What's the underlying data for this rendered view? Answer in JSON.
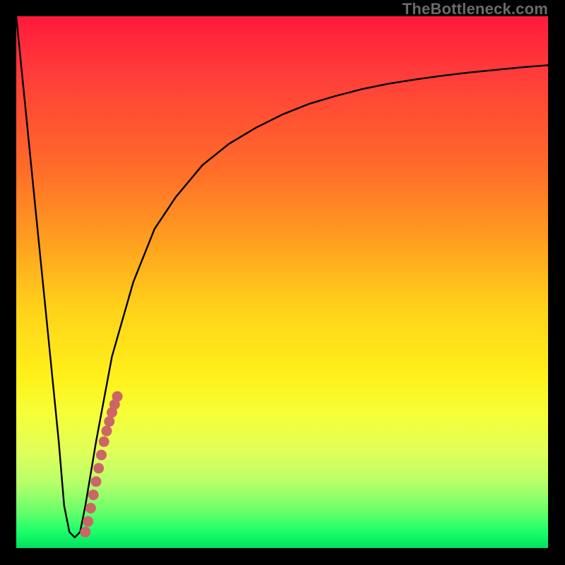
{
  "watermark": {
    "text": "TheBottleneck.com"
  },
  "colors": {
    "background": "#000000",
    "curve": "#000000",
    "marker": "#cc6666",
    "gradient_top": "#ff1a3a",
    "gradient_mid1": "#ff9e1f",
    "gradient_mid2": "#fff11a",
    "gradient_bottom": "#00e060"
  },
  "chart_data": {
    "type": "line",
    "title": "",
    "xlabel": "",
    "ylabel": "",
    "xlim": [
      0,
      100
    ],
    "ylim": [
      0,
      100
    ],
    "grid": false,
    "legend": "none",
    "annotations": [],
    "series": [
      {
        "name": "curve",
        "x": [
          0,
          2,
          4,
          6,
          8,
          9,
          10,
          11,
          12,
          13,
          15,
          18,
          22,
          26,
          30,
          35,
          40,
          45,
          50,
          55,
          60,
          65,
          70,
          75,
          80,
          85,
          90,
          95,
          100
        ],
        "y": [
          100,
          80,
          60,
          40,
          20,
          8,
          3,
          2,
          3,
          8,
          20,
          36,
          50,
          60,
          66,
          72,
          76,
          79,
          81.5,
          83.5,
          85,
          86.3,
          87.3,
          88.1,
          88.8,
          89.4,
          89.9,
          90.4,
          90.8
        ]
      }
    ],
    "markers": {
      "name": "highlight-segment",
      "x": [
        13.0,
        13.5,
        14.0,
        14.5,
        15.0,
        15.5,
        16.0,
        16.5,
        17.0,
        17.5,
        18.0,
        18.5,
        19.0
      ],
      "y": [
        3.0,
        5.0,
        7.5,
        10.0,
        12.5,
        15.0,
        17.5,
        20.0,
        22.0,
        23.8,
        25.5,
        27.0,
        28.5
      ]
    }
  }
}
